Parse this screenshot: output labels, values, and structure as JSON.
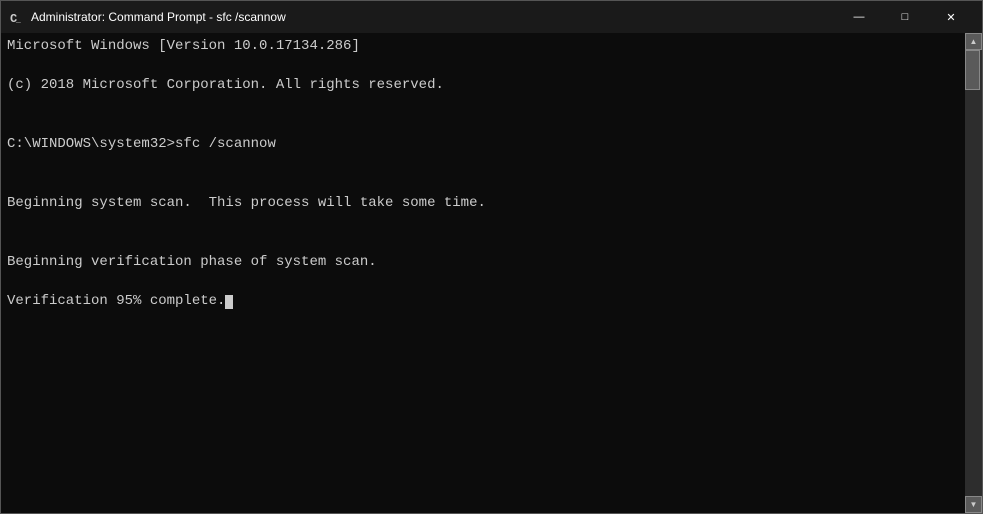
{
  "window": {
    "title": "Administrator: Command Prompt - sfc /scannow",
    "icon": "cmd-icon"
  },
  "titlebar": {
    "minimize_label": "—",
    "maximize_label": "□",
    "close_label": "✕"
  },
  "terminal": {
    "lines": [
      "Microsoft Windows [Version 10.0.17134.286]",
      "(c) 2018 Microsoft Corporation. All rights reserved.",
      "",
      "C:\\WINDOWS\\system32>sfc /scannow",
      "",
      "Beginning system scan.  This process will take some time.",
      "",
      "Beginning verification phase of system scan.",
      "Verification 95% complete."
    ]
  },
  "scrollbar": {
    "up_arrow": "▲",
    "down_arrow": "▼"
  }
}
